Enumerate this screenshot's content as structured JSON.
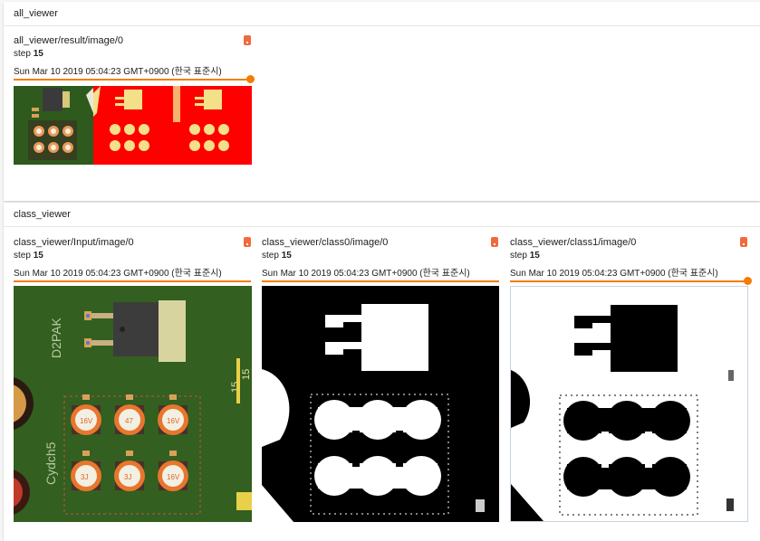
{
  "sections": {
    "all_viewer": {
      "title": "all_viewer"
    },
    "class_viewer": {
      "title": "class_viewer"
    }
  },
  "cards": {
    "result": {
      "title": "all_viewer/result/image/0",
      "step_label": "step",
      "step_value": "15",
      "timestamp": "Sun Mar 10 2019 05:04:23 GMT+0900 (한국 표준시)"
    },
    "input": {
      "title": "class_viewer/Input/image/0",
      "step_label": "step",
      "step_value": "15",
      "timestamp": "Sun Mar 10 2019 05:04:23 GMT+0900 (한국 표준시)"
    },
    "class0": {
      "title": "class_viewer/class0/image/0",
      "step_label": "step",
      "step_value": "15",
      "timestamp": "Sun Mar 10 2019 05:04:23 GMT+0900 (한국 표준시)"
    },
    "class1": {
      "title": "class_viewer/class1/image/0",
      "step_label": "step",
      "step_value": "15",
      "timestamp": "Sun Mar 10 2019 05:04:23 GMT+0900 (한국 표준시)"
    }
  },
  "pcb_labels": {
    "package": "D2PAK",
    "series": "Cydch5",
    "cap_texts": [
      "3J",
      "47",
      "16V"
    ],
    "marker": "15",
    "marker2": "15"
  },
  "colors": {
    "accent": "#f57c00",
    "expand_button": "#f06b3c",
    "segmentation_red": "#ff0000",
    "segmentation_yellow": "#f5e08a",
    "pcb_green": "#2f5a1e"
  }
}
